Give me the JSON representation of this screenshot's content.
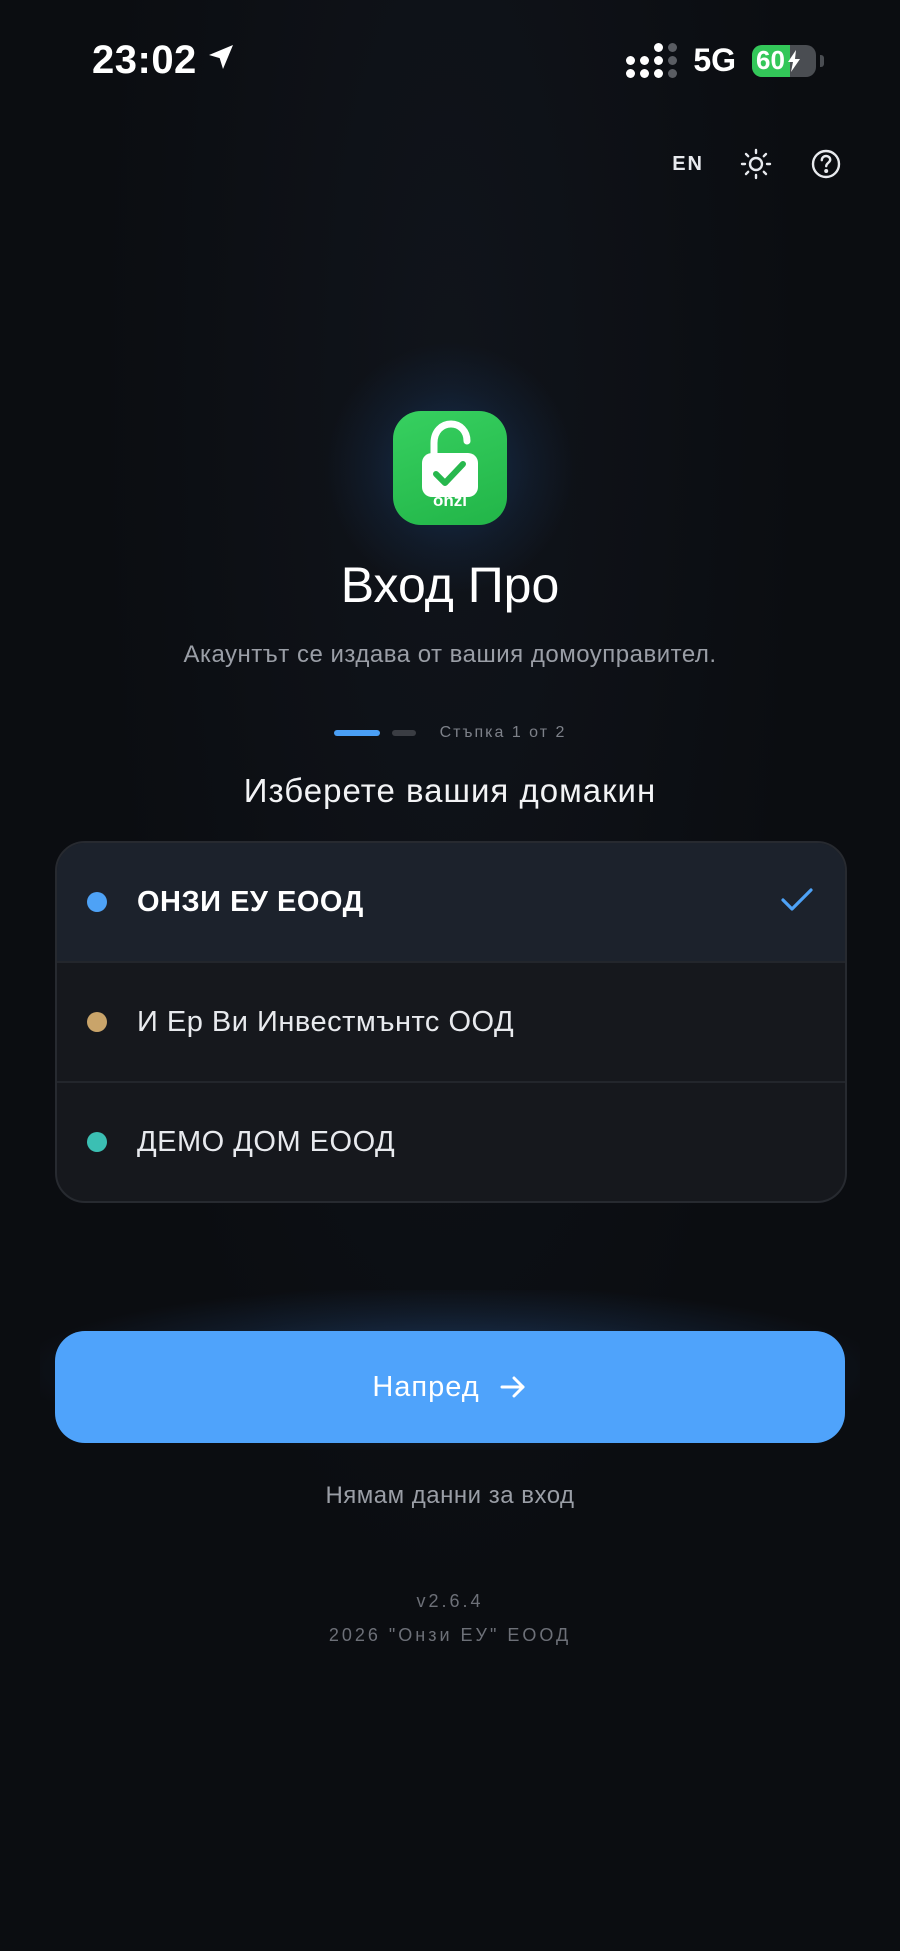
{
  "status_bar": {
    "time": "23:02",
    "network": "5G",
    "battery_level": "60",
    "battery_percent": 60,
    "battery_color": "#33c759"
  },
  "top_tools": {
    "language_label": "EN",
    "theme_icon": "sun-icon",
    "help_icon": "help-circle-icon"
  },
  "logo": {
    "text": "onzi",
    "icon": "unlocked-padlock-check-icon",
    "color": "#2fc455"
  },
  "header": {
    "title": "Вход Про",
    "subtitle": "Акаунтът се издава от вашия домоуправител."
  },
  "stepper": {
    "current_step": 1,
    "total_steps": 2,
    "label": "Стъпка 1 от 2"
  },
  "host_selection": {
    "title": "Изберете вашия домакин",
    "items": [
      {
        "label": "ОНЗИ ЕУ ЕООД",
        "dot_color": "#4ea2f6",
        "selected": true
      },
      {
        "label": "И Ер Ви Инвестмънтс ООД",
        "dot_color": "#c9a46a",
        "selected": false
      },
      {
        "label": "ДЕМО ДОМ ЕООД",
        "dot_color": "#3bbfb3",
        "selected": false
      }
    ]
  },
  "actions": {
    "next_label": "Напред",
    "no_credentials_label": "Нямам данни за вход"
  },
  "footer": {
    "version": "v2.6.4",
    "copyright": "2026 \"Онзи ЕУ\" ЕООД"
  },
  "colors": {
    "accent": "#4fa3fb",
    "background": "#0b0d11"
  }
}
